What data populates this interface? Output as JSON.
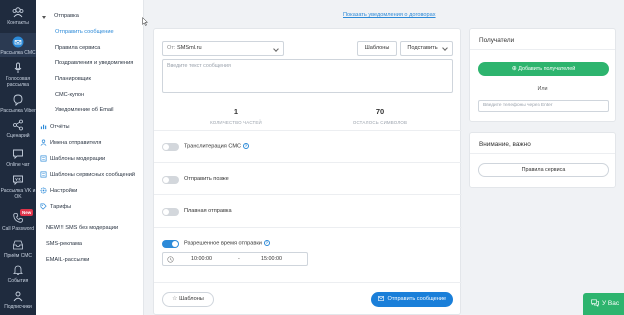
{
  "rail": {
    "items": [
      {
        "label": "Контакты",
        "icon": "contacts-icon"
      },
      {
        "label": "Рассылка СМС",
        "icon": "mail-icon"
      },
      {
        "label": "Голосовая рассылка",
        "icon": "microphone-icon"
      },
      {
        "label": "Рассылка Viber",
        "icon": "viber-icon"
      },
      {
        "label": "Сценарий",
        "icon": "share-icon"
      },
      {
        "label": "Online чат",
        "icon": "chat-icon"
      },
      {
        "label": "Рассылка VK и OK",
        "icon": "vk-icon"
      },
      {
        "label": "Call Password",
        "icon": "phone-icon",
        "badge": "New"
      },
      {
        "label": "Приём СМС",
        "icon": "inbox-icon"
      },
      {
        "label": "События",
        "icon": "bell-icon"
      },
      {
        "label": "Подписчики",
        "icon": "users-icon"
      }
    ]
  },
  "submenu": {
    "send_header": "Отправка",
    "send_items": [
      "Отправить сообщение",
      "Правила сервиса",
      "Поздравления и уведомления",
      "Планировщик",
      "СМС-купон",
      "Уведомление об Email"
    ],
    "groups": [
      "Отчёты",
      "Имена отправителя",
      "Шаблоны модерации",
      "Шаблоны сервисных сообщений",
      "Настройки",
      "Тарифы"
    ],
    "extras": [
      "NEW!!! SMS без модерации",
      "SMS-реклама",
      "EMAIL-рассылки"
    ]
  },
  "top_link": "Показать уведомления о договорах",
  "compose": {
    "sender_label": "От:",
    "sender_value": "SMSml.ru",
    "templates_button": "Шаблоны",
    "insert_button": "Подставить",
    "text_placeholder": "Введите текст сообщения",
    "parts_count": "1",
    "parts_label": "КОЛИЧЕСТВО ЧАСТЕЙ",
    "chars_left": "70",
    "chars_label": "ОСТАЛОСЬ СИМВОЛОВ",
    "options": [
      {
        "label": "Транслитерация СМС",
        "on": false,
        "help": true
      },
      {
        "label": "Отправить позже",
        "on": false,
        "help": false
      },
      {
        "label": "Плавная отправка",
        "on": false,
        "help": false
      },
      {
        "label": "Разрешенное время отправки",
        "on": true,
        "help": true
      }
    ],
    "time_from": "10:00:00",
    "time_sep": "-",
    "time_to": "15:00:00",
    "footer_templates_button": "Шаблоны",
    "send_button": "Отправить сообщение"
  },
  "recipients": {
    "title": "Получатели",
    "add_button": "Добавить получателей",
    "or_label": "Или",
    "phone_placeholder": "Введите телефоны через Enter"
  },
  "notice": {
    "title": "Внимание, важно",
    "rules_button": "Правила сервиса"
  },
  "chat_widget": {
    "label": "У Вас"
  },
  "colors": {
    "accent": "#1a7fd9",
    "success": "#2db46e",
    "rail": "#1f2b3e"
  }
}
